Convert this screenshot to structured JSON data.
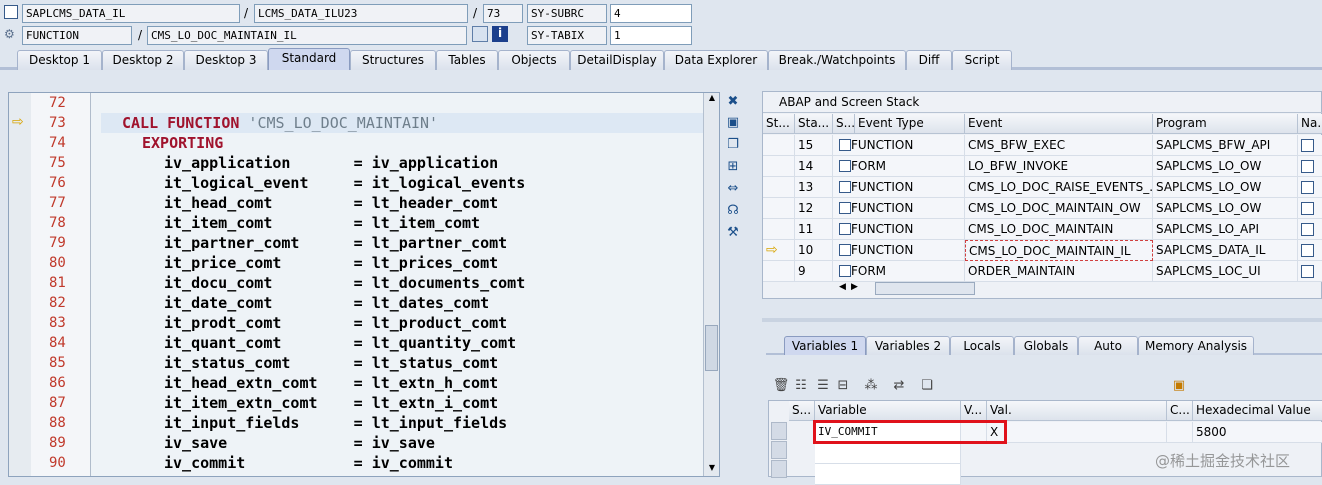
{
  "header": {
    "program": "SAPLCMS_DATA_IL",
    "include": "LCMS_DATA_ILU23",
    "line": "73",
    "subrc_label": "SY-SUBRC",
    "subrc_value": "4",
    "event_type": "FUNCTION",
    "event_name": "CMS_LO_DOC_MAINTAIN_IL",
    "tabix_label": "SY-TABIX",
    "tabix_value": "1",
    "sep1": "/",
    "sep2": "/",
    "sep3": "/"
  },
  "main_tabs": [
    "Desktop 1",
    "Desktop 2",
    "Desktop 3",
    "Standard",
    "Structures",
    "Tables",
    "Objects",
    "DetailDisplay",
    "Data Explorer",
    "Break./Watchpoints",
    "Diff",
    "Script"
  ],
  "code_lines": [
    {
      "no": "72",
      "pre": "",
      "kw": "",
      "text": ""
    },
    {
      "no": "73",
      "pre": "  ",
      "kw": "CALL FUNCTION",
      "text": " 'CMS_LO_DOC_MAINTAIN'"
    },
    {
      "no": "74",
      "pre": "    ",
      "kw": "EXPORTING",
      "text": ""
    },
    {
      "no": "75",
      "pre": "      ",
      "kw": "",
      "text": "iv_application       = iv_application"
    },
    {
      "no": "76",
      "pre": "      ",
      "kw": "",
      "text": "it_logical_event     = it_logical_events"
    },
    {
      "no": "77",
      "pre": "      ",
      "kw": "",
      "text": "it_head_comt         = lt_header_comt"
    },
    {
      "no": "78",
      "pre": "      ",
      "kw": "",
      "text": "it_item_comt         = lt_item_comt"
    },
    {
      "no": "79",
      "pre": "      ",
      "kw": "",
      "text": "it_partner_comt      = lt_partner_comt"
    },
    {
      "no": "80",
      "pre": "      ",
      "kw": "",
      "text": "it_price_comt        = lt_prices_comt"
    },
    {
      "no": "81",
      "pre": "      ",
      "kw": "",
      "text": "it_docu_comt         = lt_documents_comt"
    },
    {
      "no": "82",
      "pre": "      ",
      "kw": "",
      "text": "it_date_comt         = lt_dates_comt"
    },
    {
      "no": "83",
      "pre": "      ",
      "kw": "",
      "text": "it_prodt_comt        = lt_product_comt"
    },
    {
      "no": "84",
      "pre": "      ",
      "kw": "",
      "text": "it_quant_comt        = lt_quantity_comt"
    },
    {
      "no": "85",
      "pre": "      ",
      "kw": "",
      "text": "it_status_comt       = lt_status_comt"
    },
    {
      "no": "86",
      "pre": "      ",
      "kw": "",
      "text": "it_head_extn_comt    = lt_extn_h_comt"
    },
    {
      "no": "87",
      "pre": "      ",
      "kw": "",
      "text": "it_item_extn_comt    = lt_extn_i_comt"
    },
    {
      "no": "88",
      "pre": "      ",
      "kw": "",
      "text": "it_input_fields      = lt_input_fields"
    },
    {
      "no": "89",
      "pre": "      ",
      "kw": "",
      "text": "iv_save              = iv_save"
    },
    {
      "no": "90",
      "pre": "      ",
      "kw": "",
      "text": "iv_commit            = iv_commit"
    }
  ],
  "stack": {
    "title": "ABAP and Screen Stack",
    "columns": [
      "St...",
      "Sta...",
      "S...",
      "Event Type",
      "Event",
      "Program",
      "Na..."
    ],
    "rows": [
      {
        "level": "15",
        "type": "FUNCTION",
        "event": "CMS_BFW_EXEC",
        "program": "SAPLCMS_BFW_API",
        "current": false
      },
      {
        "level": "14",
        "type": "FORM",
        "event": "LO_BFW_INVOKE",
        "program": "SAPLCMS_LO_OW",
        "current": false
      },
      {
        "level": "13",
        "type": "FUNCTION",
        "event": "CMS_LO_DOC_RAISE_EVENTS_...",
        "program": "SAPLCMS_LO_OW",
        "current": false
      },
      {
        "level": "12",
        "type": "FUNCTION",
        "event": "CMS_LO_DOC_MAINTAIN_OW",
        "program": "SAPLCMS_LO_OW",
        "current": false
      },
      {
        "level": "11",
        "type": "FUNCTION",
        "event": "CMS_LO_DOC_MAINTAIN",
        "program": "SAPLCMS_LO_API",
        "current": false
      },
      {
        "level": "10",
        "type": "FUNCTION",
        "event": "CMS_LO_DOC_MAINTAIN_IL",
        "program": "SAPLCMS_DATA_IL",
        "current": true
      },
      {
        "level": "9",
        "type": "FORM",
        "event": "ORDER_MAINTAIN",
        "program": "SAPLCMS_LOC_UI",
        "current": false
      }
    ]
  },
  "var_tabs": [
    "Variables 1",
    "Variables 2",
    "Locals",
    "Globals",
    "Auto",
    "Memory Analysis"
  ],
  "vars": {
    "columns": [
      "S...",
      "Variable",
      "V...",
      "Val.",
      "C...",
      "Hexadecimal Value"
    ],
    "rows": [
      {
        "name": "IV_COMMIT",
        "val": "X",
        "hex": "5800"
      }
    ]
  },
  "watermark": "@稀土掘金技术社区",
  "colors": {
    "highlight_box": "#e0121b",
    "keyword": "#a0132d",
    "line_number": "#c0392b"
  }
}
